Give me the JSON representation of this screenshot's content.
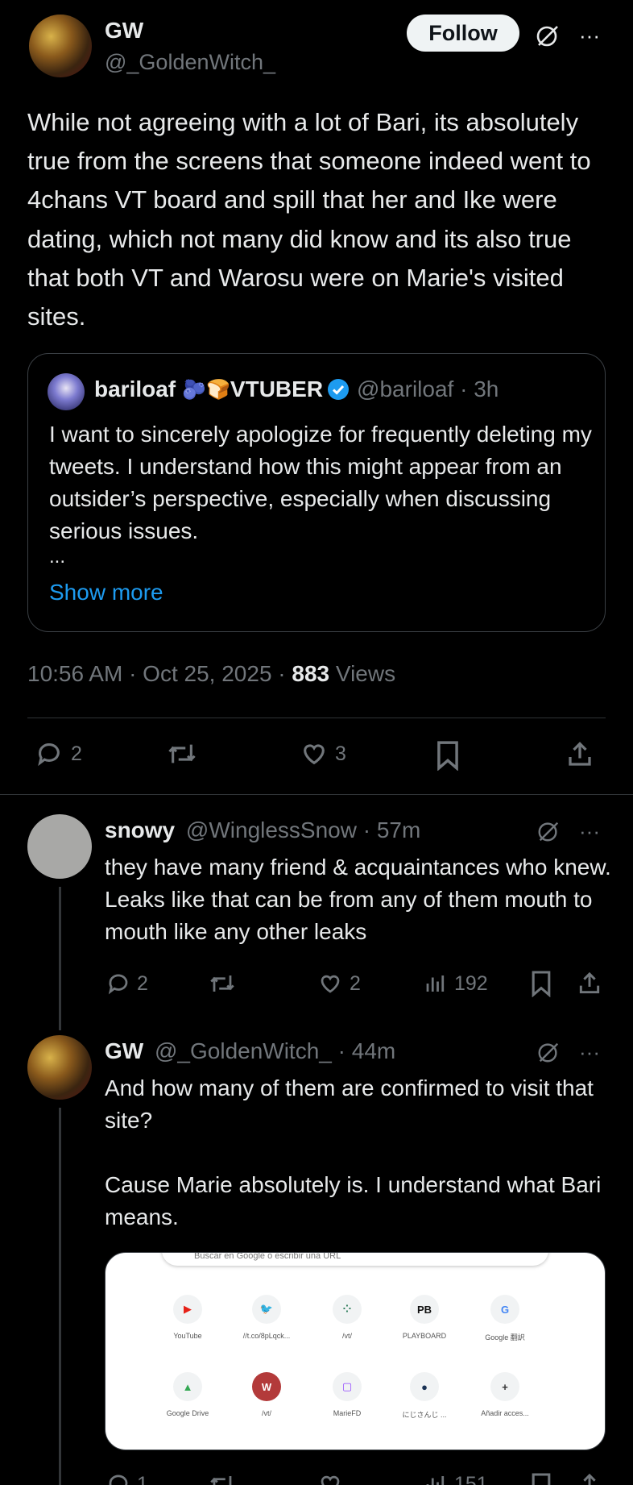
{
  "main_tweet": {
    "display_name": "GW",
    "handle": "@_GoldenWitch_",
    "follow_label": "Follow",
    "more_label": "···",
    "text": "While not agreeing with a lot of Bari, its absolutely true from the screens that someone indeed went to 4chans VT board and spill that her and Ike were dating, which not many did know and its also true that both VT and Warosu were on Marie's visited sites.",
    "timestamp": "10:56 AM · Oct 25, 2025 · ",
    "views_count": "883",
    "views_label": " Views",
    "actions": {
      "replies": "2",
      "reposts": "",
      "likes": "3"
    }
  },
  "quote": {
    "display_name": "bariloaf",
    "name_suffix": "VTUBER",
    "emoji_1": "🫐",
    "emoji_2": "🍞",
    "handle_time": "@bariloaf · 3h",
    "text": "I want to sincerely apologize for frequently deleting my tweets. I understand how this might appear from an outsider’s perspective, especially when discussing serious issues.",
    "ellipsis": "...",
    "show_more": "Show more"
  },
  "replies": [
    {
      "display_name": "snowy",
      "handle_time": "@WinglessSnow · 57m",
      "text": "they have many friend & acquaintances who knew. Leaks like that can be from any of them mouth to mouth like any other leaks",
      "actions": {
        "replies": "2",
        "reposts": "",
        "likes": "2",
        "views": "192"
      }
    },
    {
      "display_name": "GW",
      "handle_time": "@_GoldenWitch_ · 44m",
      "text_1": "And how many of them are confirmed to visit that site?",
      "text_2": "Cause Marie absolutely is. I understand what Bari means.",
      "actions": {
        "replies": "1",
        "views": "151"
      }
    }
  ],
  "media": {
    "search_placeholder": "Buscar en Google o escribir una URL",
    "tiles": [
      {
        "label": "YouTube",
        "icon": "▶",
        "color": "#e62117"
      },
      {
        "label": "//t.co/8pLqck...",
        "icon": "🐦",
        "color": "#1d9bf0"
      },
      {
        "label": "/vt/",
        "icon": "⁘",
        "color": "#2e7d5b"
      },
      {
        "label": "PLAYBOARD",
        "icon": "PB",
        "color": "#111111"
      },
      {
        "label": "Google 翻訳",
        "icon": "G",
        "color": "#4285f4"
      },
      {
        "label": "Google Drive",
        "icon": "▲",
        "color": "#34a853"
      },
      {
        "label": "/vt/",
        "icon": "W",
        "color": "#ffffff"
      },
      {
        "label": "MarieFD",
        "icon": "▢",
        "color": "#9146ff"
      },
      {
        "label": "にじさんじ ...",
        "icon": "●",
        "color": "#1a3355"
      },
      {
        "label": "Añadir acces...",
        "icon": "+",
        "color": "#333333"
      }
    ]
  },
  "colors": {
    "background": "#000000",
    "text": "#e7e9ea",
    "muted": "#71767b",
    "link": "#1d9bf0",
    "verified": "#1d9bf0"
  }
}
